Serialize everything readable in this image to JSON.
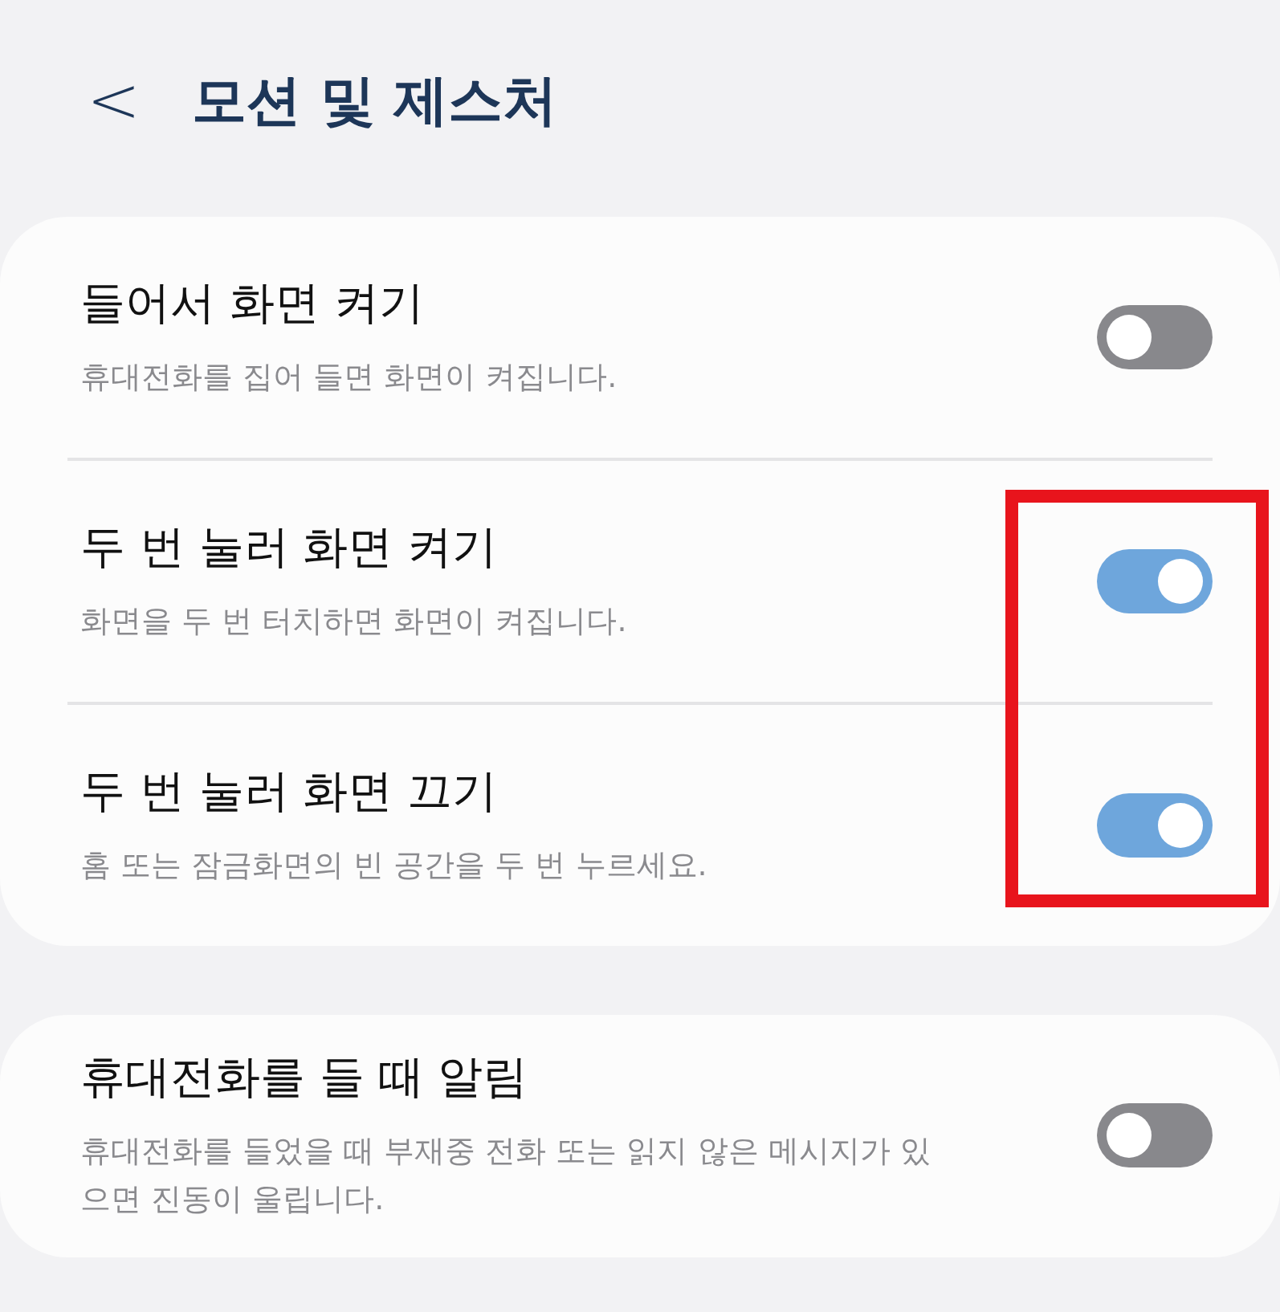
{
  "header": {
    "back": "<",
    "title": "모션 및 제스처"
  },
  "groups": [
    {
      "items": [
        {
          "title": "들어서 화면 켜기",
          "subtitle": "휴대전화를 집어 들면 화면이 켜집니다.",
          "on": false
        },
        {
          "title": "두 번 눌러 화면 켜기",
          "subtitle": "화면을 두 번 터치하면 화면이 켜집니다.",
          "on": true
        },
        {
          "title": "두 번 눌러 화면 끄기",
          "subtitle": "홈 또는 잠금화면의 빈 공간을 두 번 누르세요.",
          "on": true
        }
      ],
      "annotation": {
        "kind": "highlight-box"
      }
    },
    {
      "items": [
        {
          "title": "휴대전화를 들 때 알림",
          "subtitle": "휴대전화를 들었을 때 부재중 전화 또는 읽지 않은 메시지가 있으면 진동이 울립니다.",
          "on": false
        }
      ]
    }
  ]
}
